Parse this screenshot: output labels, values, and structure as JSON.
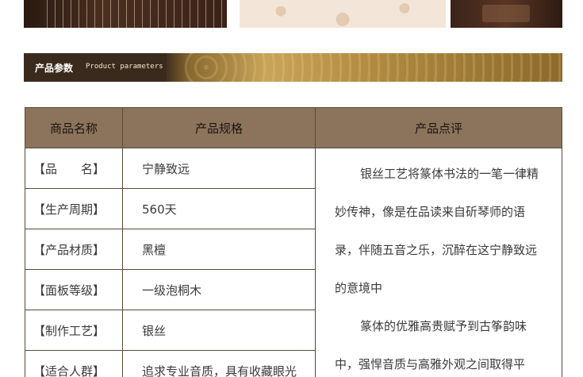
{
  "banner": {
    "title": "产品参数",
    "subtitle": "Product parameters"
  },
  "table": {
    "headers": [
      "商品名称",
      "产品规格",
      "产品点评"
    ],
    "rows": [
      {
        "name": "【品　　名】",
        "value": "宁静致远"
      },
      {
        "name": "【生产周期】",
        "value": "560天"
      },
      {
        "name": "【产品材质】",
        "value": "黑檀"
      },
      {
        "name": "【面板等级】",
        "value": "一级泡桐木"
      },
      {
        "name": "【制作工艺】",
        "value": "银丝"
      },
      {
        "name": "【适合人群】",
        "value": "追求专业音质，具有收藏眼光"
      }
    ],
    "review": {
      "p1": "银丝工艺将篆体书法的一笔一律精妙传神，像是在品读来自斫琴师的语录，伴随五音之乐，沉醉在这宁静致远的意境中",
      "p2": "篆体的优雅高贵赋予到古筝韵味中，强悍音质与高雅外观之间取得平"
    }
  }
}
